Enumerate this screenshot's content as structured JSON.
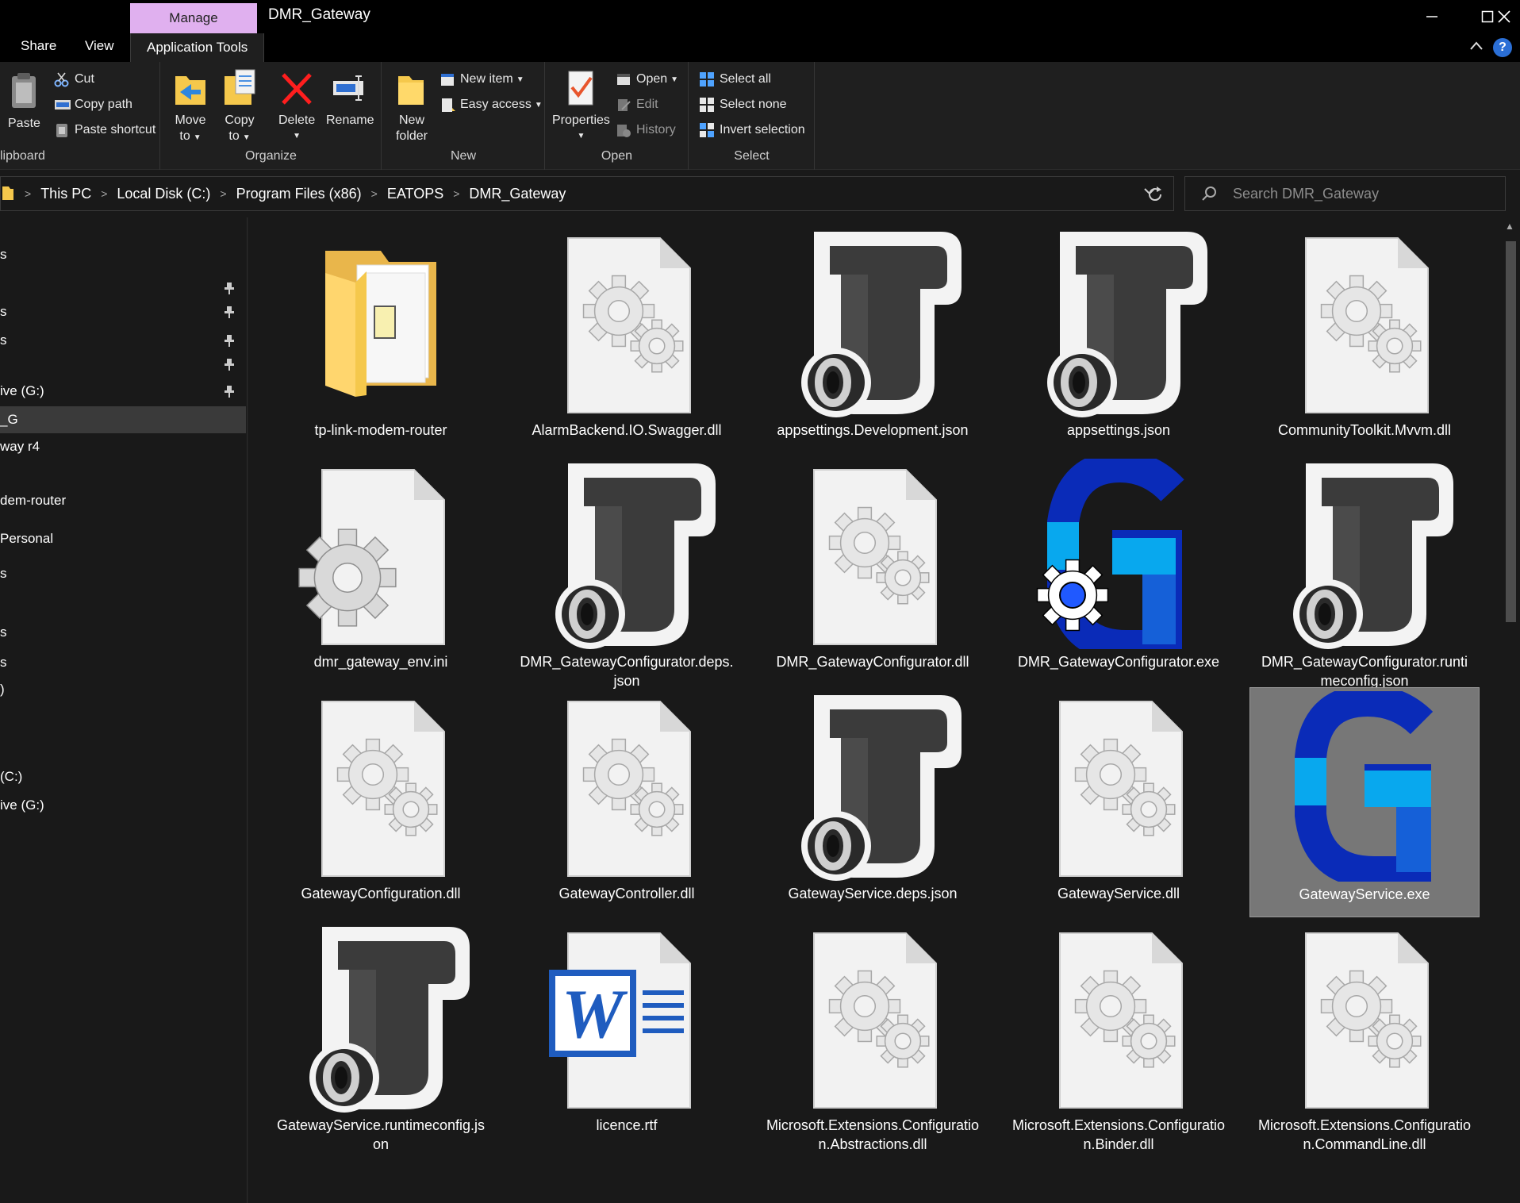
{
  "window": {
    "title": "DMR_Gateway",
    "contextual_tab": "Manage",
    "controls": [
      "minimize",
      "maximize",
      "close"
    ]
  },
  "tabs": {
    "share": "Share",
    "view": "View",
    "application_tools": "Application Tools"
  },
  "ribbon": {
    "clipboard": {
      "label": "lipboard",
      "paste": "Paste",
      "cut": "Cut",
      "copy_path": "Copy path",
      "paste_shortcut": "Paste shortcut"
    },
    "organize": {
      "label": "Organize",
      "move_to_1": "Move",
      "move_to_2": "to",
      "copy_to_1": "Copy",
      "copy_to_2": "to",
      "delete": "Delete",
      "rename": "Rename"
    },
    "new": {
      "label": "New",
      "new_folder_1": "New",
      "new_folder_2": "folder",
      "new_item": "New item",
      "easy_access": "Easy access"
    },
    "open": {
      "label": "Open",
      "properties": "Properties",
      "open": "Open",
      "edit": "Edit",
      "history": "History"
    },
    "select": {
      "label": "Select",
      "select_all": "Select all",
      "select_none": "Select none",
      "invert_selection": "Invert selection"
    }
  },
  "address": {
    "crumbs": [
      "This PC",
      "Local Disk (C:)",
      "Program Files (x86)",
      "EATOPS",
      "DMR_Gateway"
    ],
    "search_placeholder": "Search DMR_Gateway"
  },
  "nav": {
    "items": [
      {
        "label": "s",
        "pinned": false,
        "selected": false
      },
      {
        "label": "",
        "pinned": true,
        "selected": false
      },
      {
        "label": "s",
        "pinned": true,
        "selected": false
      },
      {
        "label": "s",
        "pinned": true,
        "selected": false
      },
      {
        "label": "",
        "pinned": true,
        "selected": false
      },
      {
        "label": "ive (G:)",
        "pinned": true,
        "selected": false
      },
      {
        "label": "_G",
        "pinned": false,
        "selected": true
      },
      {
        "label": "way r4",
        "pinned": false,
        "selected": false
      },
      {
        "label": "dem-router",
        "pinned": false,
        "selected": false
      },
      {
        "label": "Personal",
        "pinned": false,
        "selected": false
      },
      {
        "label": "s",
        "pinned": false,
        "selected": false
      },
      {
        "label": "s",
        "pinned": false,
        "selected": false
      },
      {
        "label": "s",
        "pinned": false,
        "selected": false
      },
      {
        "label": ")",
        "pinned": false,
        "selected": false
      },
      {
        "label": "(C:)",
        "pinned": false,
        "selected": false
      },
      {
        "label": "ive (G:)",
        "pinned": false,
        "selected": false
      }
    ]
  },
  "files": [
    {
      "name": "tp-link-modem-router",
      "icon": "folder-icon"
    },
    {
      "name": "AlarmBackend.IO.Swagger.dll",
      "icon": "dll-file-icon"
    },
    {
      "name": "appsettings.Development.json",
      "icon": "json-file-icon"
    },
    {
      "name": "appsettings.json",
      "icon": "json-file-icon"
    },
    {
      "name": "CommunityToolkit.Mvvm.dll",
      "icon": "dll-file-icon"
    },
    {
      "name": "dmr_gateway_env.ini",
      "icon": "ini-file-icon"
    },
    {
      "name": "DMR_GatewayConfigurator.deps.json",
      "icon": "json-file-icon"
    },
    {
      "name": "DMR_GatewayConfigurator.dll",
      "icon": "dll-file-icon"
    },
    {
      "name": "DMR_GatewayConfigurator.exe",
      "icon": "configurator-exe-icon"
    },
    {
      "name": "DMR_GatewayConfigurator.runtimeconfig.json",
      "icon": "json-file-icon"
    },
    {
      "name": "GatewayConfiguration.dll",
      "icon": "dll-file-icon"
    },
    {
      "name": "GatewayController.dll",
      "icon": "dll-file-icon"
    },
    {
      "name": "GatewayService.deps.json",
      "icon": "json-file-icon"
    },
    {
      "name": "GatewayService.dll",
      "icon": "dll-file-icon"
    },
    {
      "name": "GatewayService.exe",
      "icon": "gateway-exe-icon",
      "selected": true
    },
    {
      "name": "GatewayService.runtimeconfig.json",
      "icon": "json-file-icon"
    },
    {
      "name": "licence.rtf",
      "icon": "word-document-icon"
    },
    {
      "name": "Microsoft.Extensions.Configuration.Abstractions.dll",
      "icon": "dll-file-icon"
    },
    {
      "name": "Microsoft.Extensions.Configuration.Binder.dll",
      "icon": "dll-file-icon"
    },
    {
      "name": "Microsoft.Extensions.Configuration.CommandLine.dll",
      "icon": "dll-file-icon"
    }
  ],
  "colors": {
    "manage_tab": "#e0b0ef",
    "selection": "#777777",
    "gateway_dark_blue": "#0a2bb8",
    "gateway_light_blue": "#08a8ee",
    "word_blue": "#1f5cbf"
  }
}
